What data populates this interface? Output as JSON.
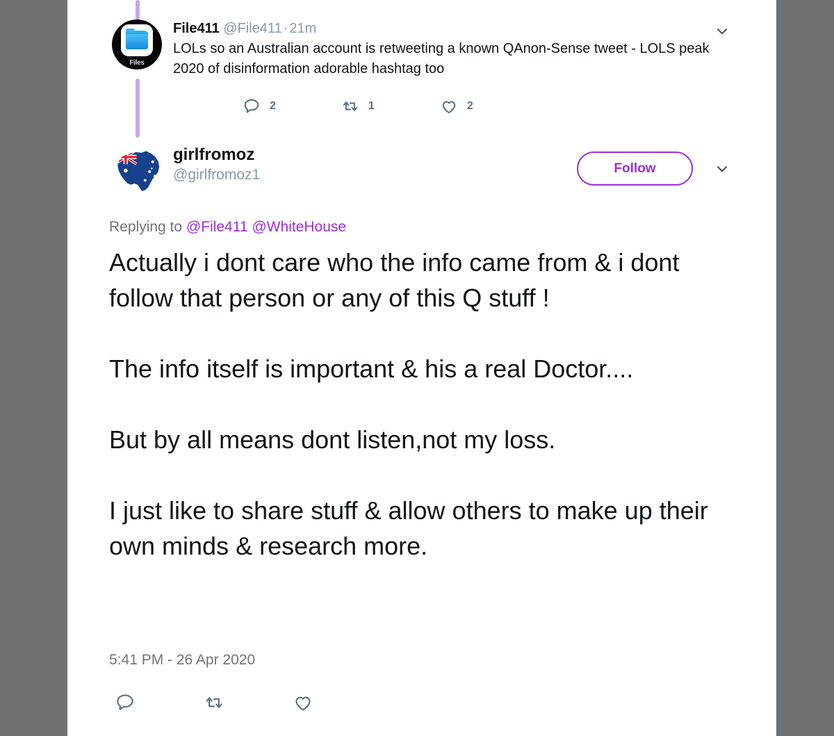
{
  "theme": {
    "page_background": "#6f7175",
    "panel_background": "#ffffff",
    "accent_purple": "#9b30d9",
    "thread_line": "#c9a5ee",
    "muted_text": "#8899a6",
    "primary_text": "#0f1419",
    "stat_text": "#5b7083"
  },
  "ancestor_tweet": {
    "avatar": {
      "icon": "files-app-folder-icon",
      "label": "Files"
    },
    "display_name": "File411",
    "handle": "@File411",
    "separator": "·",
    "timestamp": "21m",
    "text": "LOLs so an Australian account is retweeting a known QAnon-Sense tweet - LOLS peak 2020 of disinformation adorable hashtag too",
    "stats": [
      {
        "icon": "reply-icon",
        "name": "reply",
        "count": "2"
      },
      {
        "icon": "retweet-icon",
        "name": "retweet",
        "count": "1"
      },
      {
        "icon": "like-icon",
        "name": "like",
        "count": "2"
      }
    ],
    "menu_icon": "chevron-down-icon"
  },
  "focused_tweet": {
    "avatar": {
      "icon": "australia-flag-map-icon"
    },
    "display_name": "girlfromoz",
    "handle": "@girlfromoz1",
    "follow_label": "Follow",
    "menu_icon": "chevron-down-icon",
    "replying_to_prefix": "Replying to",
    "replying_to_mentions": [
      "@File411",
      "@WhiteHouse"
    ],
    "text": "Actually i dont care who the info came from & i dont follow that person or any of this Q stuff !\n\nThe info itself is important & his a real Doctor....\n\nBut by all means dont listen,not my loss.\n\nI just like to share stuff & allow others to make up their own minds & research more.",
    "timestamp": "5:41 PM - 26 Apr 2020",
    "actions": [
      {
        "icon": "reply-icon",
        "name": "reply"
      },
      {
        "icon": "retweet-icon",
        "name": "retweet"
      },
      {
        "icon": "like-icon",
        "name": "like"
      }
    ]
  }
}
